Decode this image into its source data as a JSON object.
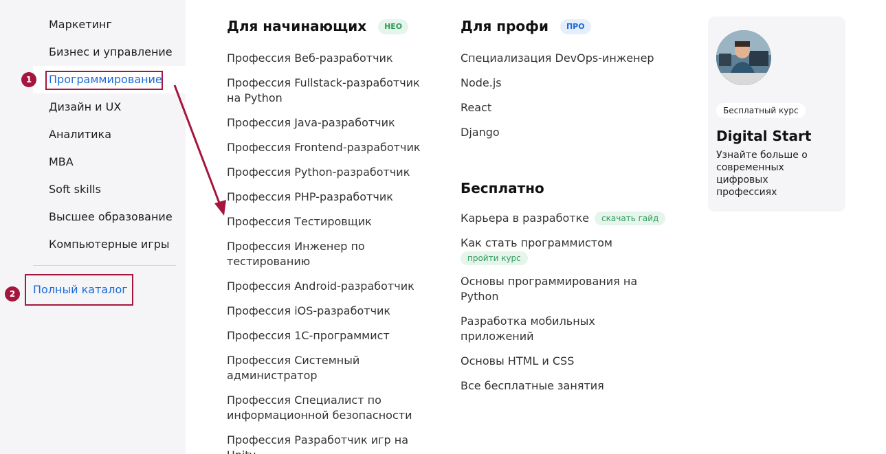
{
  "sidebar": {
    "items": [
      {
        "label": "Маркетинг"
      },
      {
        "label": "Бизнес и управление"
      },
      {
        "label": "Программирование"
      },
      {
        "label": "Дизайн и UX"
      },
      {
        "label": "Аналитика"
      },
      {
        "label": "MBA"
      },
      {
        "label": "Soft skills"
      },
      {
        "label": "Высшее образование"
      },
      {
        "label": "Компьютерные игры"
      }
    ],
    "active_index": 2,
    "catalog_label": "Полный каталог"
  },
  "annotations": {
    "marker_1": "1",
    "marker_2": "2",
    "accent_color": "#a5153d"
  },
  "beginners": {
    "title": "Для начинающих",
    "badge": "НЕО",
    "links": [
      "Профессия Веб-разработчик",
      "Профессия Fullstack-разработчик на Python",
      "Профессия Java-разработчик",
      "Профессия Frontend-разработчик",
      "Профессия Python-разработчик",
      "Профессия PHP-разработчик",
      "Профессия Тестировщик",
      "Профессия Инженер по тестированию",
      "Профессия Android-разработчик",
      "Профессия iOS-разработчик",
      "Профессия 1С-программист",
      "Профессия Системный администратор",
      "Профессия Специалист по информационной безопасности",
      "Профессия Разработчик игр на Unity"
    ]
  },
  "pros": {
    "title": "Для профи",
    "badge": "ПРО",
    "links": [
      "Специализация DevOps-инженер",
      "Node.js",
      "React",
      "Django"
    ]
  },
  "free": {
    "title": "Бесплатно",
    "links": [
      {
        "label": "Карьера в разработке",
        "tag": "скачать гайд"
      },
      {
        "label": "Как стать программистом",
        "tag": "пройти курс"
      },
      {
        "label": "Основы программирования на Python"
      },
      {
        "label": "Разработка мобильных приложений"
      },
      {
        "label": "Основы HTML и CSS"
      },
      {
        "label": "Все бесплатные занятия"
      }
    ]
  },
  "promo": {
    "badge": "Бесплатный курс",
    "title": "Digital Start",
    "description": "Узнайте больше о современных цифровых профессиях"
  }
}
